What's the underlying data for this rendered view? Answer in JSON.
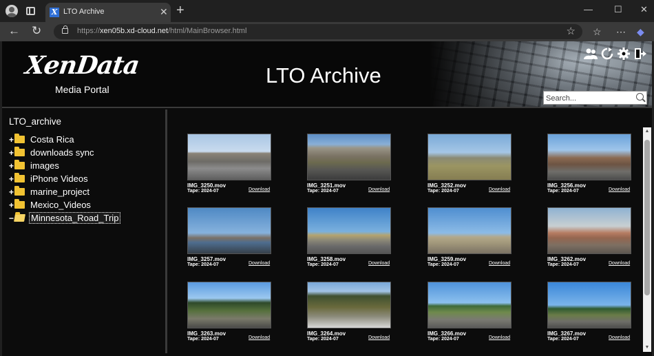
{
  "browser": {
    "tab_title": "LTO Archive",
    "url_scheme": "https://",
    "url_host": "xen05b.xd-cloud.net",
    "url_path": "/html/MainBrowser.html"
  },
  "header": {
    "logo": "XenData",
    "logo_sub": "Media Portal",
    "title": "LTO Archive",
    "search_placeholder": "Search...",
    "icons": [
      "users-icon",
      "refresh-icon",
      "gear-icon",
      "logout-icon"
    ]
  },
  "tree": {
    "root": "LTO_archive",
    "items": [
      {
        "expander": "+",
        "label": "Costa Rica",
        "open": false
      },
      {
        "expander": "+",
        "label": "downloads sync",
        "open": false
      },
      {
        "expander": "+",
        "label": "images",
        "open": false
      },
      {
        "expander": "+",
        "label": "iPhone Videos",
        "open": false
      },
      {
        "expander": "+",
        "label": "marine_project",
        "open": false
      },
      {
        "expander": "+",
        "label": "Mexico_Videos",
        "open": false
      },
      {
        "expander": "−",
        "label": "Minnesota_Road_Trip",
        "open": true
      }
    ]
  },
  "grid": {
    "download_label": "Download",
    "files": [
      {
        "name": "IMG_3250.mov",
        "tape": "Tape: 2024-07"
      },
      {
        "name": "IMG_3251.mov",
        "tape": "Tape: 2024-07"
      },
      {
        "name": "IMG_3252.mov",
        "tape": "Tape: 2024-07"
      },
      {
        "name": "IMG_3256.mov",
        "tape": "Tape: 2024-07"
      },
      {
        "name": "IMG_3257.mov",
        "tape": "Tape: 2024-07"
      },
      {
        "name": "IMG_3258.mov",
        "tape": "Tape: 2024-07"
      },
      {
        "name": "IMG_3259.mov",
        "tape": "Tape: 2024-07"
      },
      {
        "name": "IMG_3262.mov",
        "tape": "Tape: 2024-07"
      },
      {
        "name": "IMG_3263.mov",
        "tape": "Tape: 2024-07"
      },
      {
        "name": "IMG_3264.mov",
        "tape": "Tape: 2024-07"
      },
      {
        "name": "IMG_3266.mov",
        "tape": "Tape: 2024-07"
      },
      {
        "name": "IMG_3267.mov",
        "tape": "Tape: 2024-07"
      }
    ]
  },
  "colors": {
    "background": "#0c0c0c",
    "divider": "#3a3a3a",
    "folder": "#f1c232",
    "text": "#ffffff"
  }
}
